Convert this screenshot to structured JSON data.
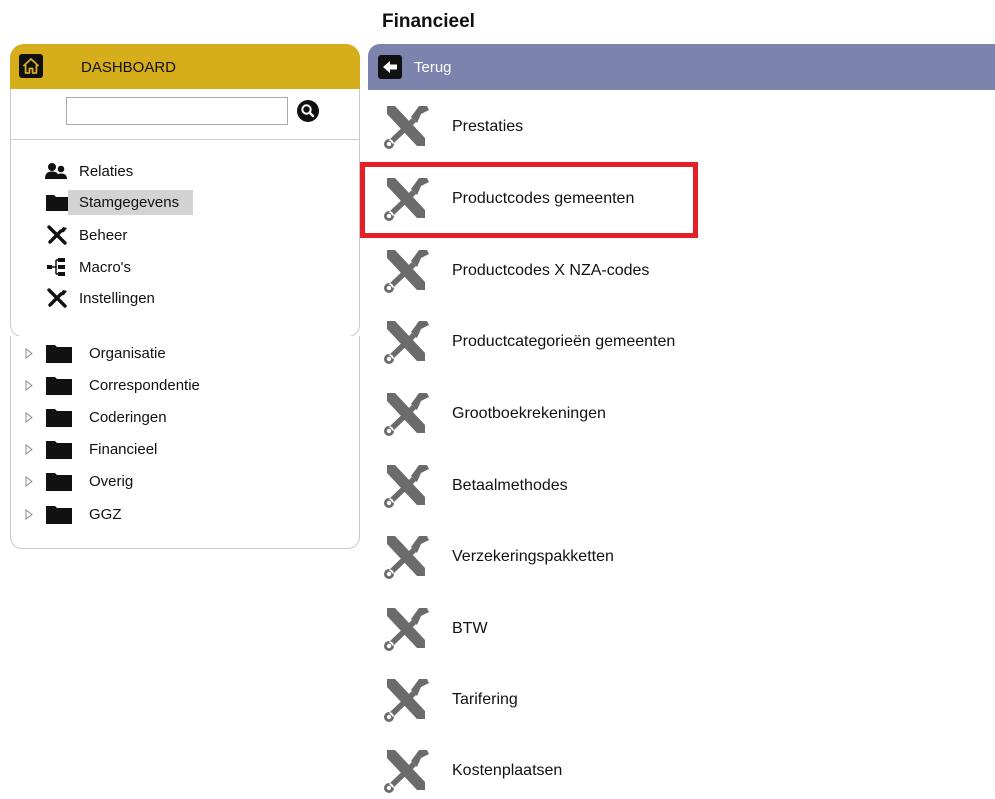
{
  "page": {
    "title": "Financieel"
  },
  "sidebar": {
    "header": {
      "label": "DASHBOARD",
      "icon": "home-icon"
    },
    "search": {
      "value": "",
      "placeholder": ""
    },
    "items": [
      {
        "label": "Relaties",
        "icon": "users-icon",
        "selected": false
      },
      {
        "label": "Stamgegevens",
        "icon": "folder-icon",
        "selected": true
      },
      {
        "label": "Beheer",
        "icon": "tools-icon",
        "selected": false
      },
      {
        "label": "Macro's",
        "icon": "hierarchy-icon",
        "selected": false
      },
      {
        "label": "Instellingen",
        "icon": "tools-icon",
        "selected": false
      }
    ],
    "tree": [
      {
        "label": "Organisatie"
      },
      {
        "label": "Correspondentie"
      },
      {
        "label": "Coderingen"
      },
      {
        "label": "Financieel"
      },
      {
        "label": "Overig"
      },
      {
        "label": "GGZ"
      }
    ]
  },
  "main": {
    "back": {
      "label": "Terug",
      "icon": "arrow-left-icon"
    },
    "items": [
      {
        "label": "Prestaties"
      },
      {
        "label": "Productcodes gemeenten",
        "highlighted": true
      },
      {
        "label": "Productcodes X NZA-codes"
      },
      {
        "label": "Productcategorieën gemeenten"
      },
      {
        "label": "Grootboekrekeningen"
      },
      {
        "label": "Betaalmethodes"
      },
      {
        "label": "Verzekeringspakketten"
      },
      {
        "label": "BTW"
      },
      {
        "label": "Tarifering"
      },
      {
        "label": "Kostenplaatsen"
      }
    ]
  },
  "colors": {
    "dashboard_header": "#d6ae1c",
    "back_bar": "#7c83ad",
    "highlight_border": "#e32028",
    "selected_item_bg": "#d3d3d3",
    "tool_icon": "#6b6b6b"
  }
}
